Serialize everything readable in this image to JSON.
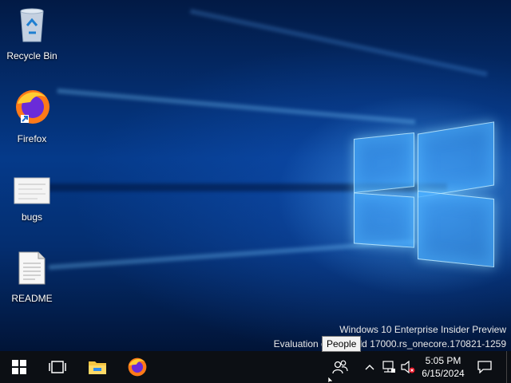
{
  "desktop": {
    "icons": [
      {
        "label": "Recycle Bin",
        "icon": "recycle-bin-icon"
      },
      {
        "label": "Firefox",
        "icon": "firefox-icon"
      },
      {
        "label": "bugs",
        "icon": "image-file-icon"
      },
      {
        "label": "README",
        "icon": "text-document-icon"
      }
    ],
    "watermark": {
      "line1": "Windows 10 Enterprise Insider Preview",
      "line2": "Evaluation copy. Build 17000.rs_onecore.170821-1259"
    }
  },
  "tooltip": {
    "text": "People"
  },
  "taskbar": {
    "start": {
      "icon": "windows-start-icon"
    },
    "task_view": {
      "icon": "task-view-icon"
    },
    "pinned": [
      {
        "name": "File Explorer",
        "icon": "file-explorer-icon"
      },
      {
        "name": "Firefox",
        "icon": "firefox-icon"
      }
    ],
    "tray": {
      "people_icon": "people-icon",
      "overflow_icon": "chevron-up-icon",
      "network_icon": "network-icon",
      "volume_icon": "volume-muted-icon",
      "time": "5:05 PM",
      "date": "6/15/2024",
      "notifications_icon": "notification-icon"
    }
  },
  "colors": {
    "taskbar": "#0c0f14",
    "wallpaper_accent": "#1e90ff"
  }
}
